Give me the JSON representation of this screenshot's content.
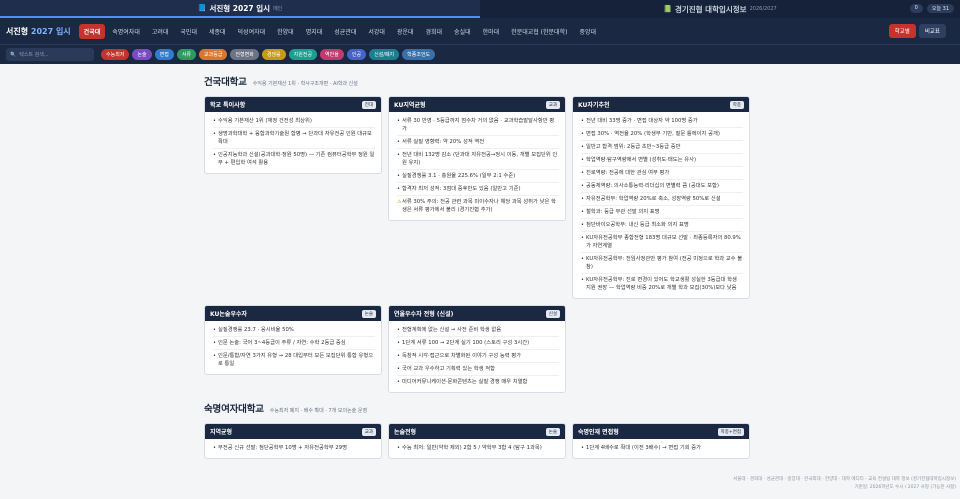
{
  "topbar": {
    "tabs": [
      {
        "label": "서진형 2027 입시",
        "sub": "메인",
        "active": true
      },
      {
        "label": "경기진협 대학입시정보",
        "sub": "2026/2027",
        "active": false
      }
    ],
    "right": [
      "0",
      "오늘 31"
    ]
  },
  "nav": {
    "brand_a": "서진형",
    "brand_b": "2027 입시",
    "items": [
      "건국대",
      "숙명여자대",
      "고려대",
      "국민대",
      "세종대",
      "덕성여자대",
      "한양대",
      "명지대",
      "성균관대",
      "서강대",
      "광운대",
      "경희대",
      "숭실대",
      "한마대",
      "한문대교협 (한문대학)",
      "중앙대"
    ],
    "btn_primary": "학교별",
    "btn_secondary": "비교표"
  },
  "filter": {
    "search_placeholder": "텍스트 검색...",
    "chips": [
      {
        "label": "수능최저",
        "color": "#c8322d"
      },
      {
        "label": "논술",
        "color": "#7a4bc4"
      },
      {
        "label": "면접",
        "color": "#2f7dd1"
      },
      {
        "label": "서류",
        "color": "#2e9a5f"
      },
      {
        "label": "교과등급",
        "color": "#d9772a"
      },
      {
        "label": "전형변화",
        "color": "#6b7385"
      },
      {
        "label": "경쟁률",
        "color": "#c59b16"
      },
      {
        "label": "지원전공",
        "color": "#1d9e8e"
      },
      {
        "label": "역반율",
        "color": "#c2396d"
      },
      {
        "label": "인공",
        "color": "#4562c9"
      },
      {
        "label": "신설/폐지",
        "color": "#1a7f8f"
      },
      {
        "label": "학종조언도",
        "color": "#3b6fa8"
      }
    ]
  },
  "schools": [
    {
      "name": "건국대학교",
      "desc": "수익용 기본재산 1위 · 학사구조개편 · AI학과 신설",
      "rows": [
        [
          {
            "title": "학교 특이사항",
            "tag": "전대",
            "items": [
              "수익용 기본재산 1위 (재정 건전성 최상위)",
              "생명과학대학 + 융합과학기술원 합병 → 단과대 자유전공 인원 대규모 확대",
              "인공지능학과 신설(공과대학·정원 50명) — 기존 컴퓨터공학부 정원 일부 + 편입학 여석 활용"
            ]
          },
          {
            "title": "KU지역균형",
            "tag": "교과",
            "items": [
              "서류 30 반영 · 5등급까지 점수차 거의 없음 · 교과학습발달사항만 평가",
              "서류 실질 영향력: 약 20% 성적 역전",
              "전년 대비 132명 감소 (단과대 자유전공→정시 이동, 개별 모집단위 인원 유지)",
              "실질경쟁률 3.1 · 충원율 225.6% (일부 2:1 수준)",
              "합격자 최저 성적: 3점대 중후반도 있음 (일반고 기준)",
              "서류 30% 주의: 전공 관련 과목 미이수자나 해당 과목 성취가 낮은 학생은 서류 평가에서 불리 (경기진협 추가)"
            ],
            "warn": [
              5
            ]
          },
          {
            "title": "KU자기추천",
            "tag": "학종",
            "items": [
              "전년 대비 33명 증가 · 면접 대상자 약 100명 증가",
              "면접 30% · 역전율 20% (학생부 기반, 질문 틀에이지 공개)",
              "일반고 합격 범위: 2등급 초반~3등급 중반",
              "학업역량·탐구역량에서 변별 (성취도·태도는 유사)",
              "진로역량: 전공에 대한 관심 여부 평가",
              "공동체역량: 의사소통능력·리더십의 변별력 큼 (공대도 포함)",
              "자유전공학부: 학업역량 20%로 축소, 성장역량 50%로 신설",
              "철학과: 등급 무관 선발 의지 표명",
              "첨단바이오공학부: 내신 등급 최소화 의지 표명",
              "KU자유전공학부 종합전형 183명 대규모 선발 · 최종등록자의 80.9%가 자연계열",
              "KU자유전공학부: 전임사정관만 평가 참여 (전공 미정으로 학과 교수 불참)",
              "KU자유전공학부: 진로 변경이 있어도 학교생활 성실한 3등급대 학생 지원 권장 — 학업역량 비중 20%로 개별 학과 모집(30%)보다 낮음"
            ]
          }
        ],
        [
          {
            "title": "KU논술우수자",
            "tag": "논술",
            "items": [
              "실질경쟁률 23.7 · 응시비율 50%",
              "인문 논술: 국어 3~4등급이 주류 / 자연: 수학 2등급 중심",
              "인문/통합/자연 3가지 유형 → 28 대입부터 모든 모집단위 통합 유형으로 통일"
            ]
          },
          {
            "title": "연울우수자 전형 (신설)",
            "tag": "신설",
            "items": [
              "전형계획에 없는 신설 → 사전 준비 학생 없음",
              "1단계 서류 100 → 2단계 실기 100 (스토리 구성 3시간)",
              "독창적 시각·접근으로 차별화된 이야기 구성 능력 평가",
              "국어 교과 우수하고 기획력 있는 학생 적합",
              "미디어커뮤니케이션·문화콘텐츠는 실질 경쟁 매우 치열함"
            ]
          }
        ]
      ]
    },
    {
      "name": "숙명여자대학교",
      "desc": "수능최저 폐지 · 배수 확대 · 7개 모의논술 운영",
      "rows": [
        [
          {
            "title": "지역균형",
            "tag": "교과",
            "items": [
              "무전공 신규 선발: 첨단공학부 10명 + 자유전공학부 29명"
            ]
          },
          {
            "title": "논술전형",
            "tag": "논술",
            "items": [
              "수능 최저: 일반(약학 제외) 2합 5 / 약학부 3합 4 (탐구 1과목)"
            ]
          },
          {
            "title": "숙명인재 면접형",
            "tag": "학종+면접",
            "items": [
              "1단계 4배수로 확대 (이전 3배수) → 면접 기회 증가"
            ]
          }
        ]
      ]
    }
  ],
  "footer_note": [
    "서울대 · 경희대 · 성균관대 · 중앙대 · 한국외대 · 한양대 · 대학 에디티 · 교육 컨설팅 대학 정보 (경기진협대학입시정보)",
    "기준일: 2026학년도 수시 / 2027 사정 (가능한 사항)"
  ]
}
